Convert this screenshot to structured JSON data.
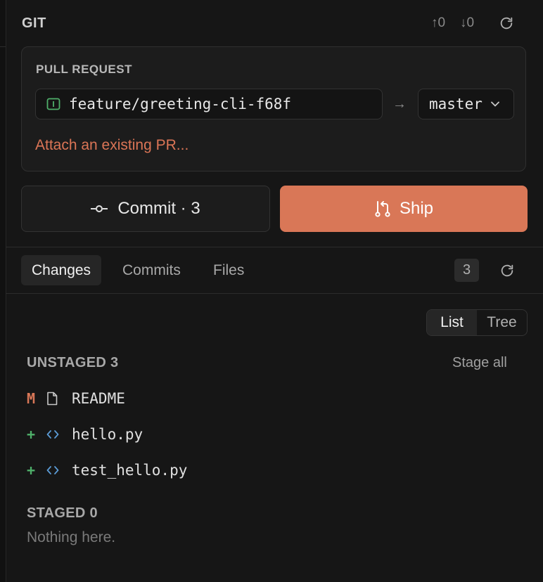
{
  "panel": {
    "title": "GIT",
    "ahead": "↑0",
    "behind": "↓0"
  },
  "pull_request": {
    "label": "PULL REQUEST",
    "source_branch": "feature/greeting-cli-f68f",
    "arrow": "→",
    "target_branch": "master",
    "attach_link": "Attach an existing PR..."
  },
  "actions": {
    "commit_label": "Commit · 3",
    "ship_label": "Ship"
  },
  "tabs": [
    {
      "label": "Changes",
      "active": true
    },
    {
      "label": "Commits",
      "active": false
    },
    {
      "label": "Files",
      "active": false
    }
  ],
  "changes_count": "3",
  "view": {
    "list_label": "List",
    "tree_label": "Tree",
    "selected": "List"
  },
  "unstaged": {
    "title": "UNSTAGED 3",
    "stage_all": "Stage all",
    "files": [
      {
        "status": "M",
        "icon": "file-icon",
        "name": "README"
      },
      {
        "status": "+",
        "icon": "code-icon",
        "name": "hello.py"
      },
      {
        "status": "+",
        "icon": "code-icon",
        "name": "test_hello.py"
      }
    ]
  },
  "staged": {
    "title": "STAGED 0",
    "empty_text": "Nothing here."
  },
  "colors": {
    "accent": "#d97757",
    "added": "#4fb06a",
    "code_icon": "#5b9bd5"
  }
}
